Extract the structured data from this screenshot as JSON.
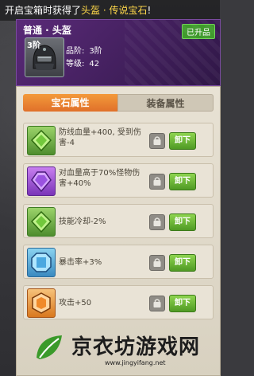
{
  "notice": {
    "prefix": "开启宝箱时获得了",
    "highlight": "头盔 · 传说宝石",
    "suffix": "!"
  },
  "item": {
    "name": "普通 · 头盔",
    "upgraded_badge": "已升品",
    "tier": "3阶",
    "quality_label": "品阶:",
    "quality_value": "3阶",
    "level_label": "等级:",
    "level_value": "42"
  },
  "tabs": {
    "gem": "宝石属性",
    "equip": "装备属性"
  },
  "gems": [
    {
      "color": "green",
      "desc": "防线血量+400, 受到伤害-4",
      "button": "卸下"
    },
    {
      "color": "purple",
      "desc": "对血量高于70%怪物伤害+40%",
      "button": "卸下"
    },
    {
      "color": "green",
      "desc": "技能冷却-2%",
      "button": "卸下"
    },
    {
      "color": "blue",
      "desc": "暴击率+3%",
      "button": "卸下"
    },
    {
      "color": "orange",
      "desc": "攻击+50",
      "button": "卸下"
    }
  ],
  "watermark": {
    "title": "京衣坊游戏网",
    "url": "www.jingyifang.net"
  },
  "colors": {
    "accent_orange": "#e0702a",
    "button_green": "#5aa82c",
    "header_purple": "#4a2266"
  }
}
